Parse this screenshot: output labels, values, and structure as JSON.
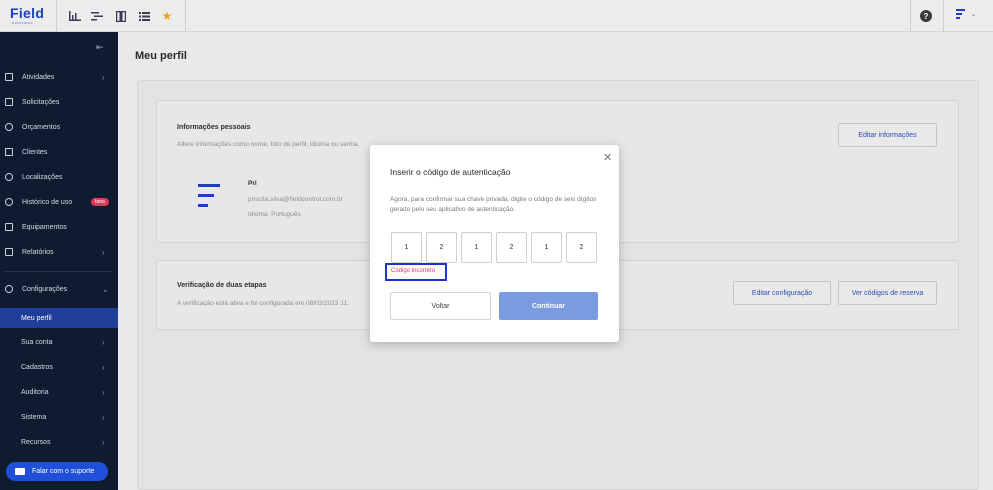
{
  "app": {
    "logo": "Field",
    "logo_sub": "CONTROL"
  },
  "topbar": {
    "icons": [
      "bar-chart-icon",
      "gantt-icon",
      "map-book-icon",
      "list-icon",
      "star-icon"
    ],
    "help": "?",
    "accent": "#1d3fbf"
  },
  "sidebar": {
    "items": [
      {
        "label": "Atividades",
        "icon": "clipboard-icon"
      },
      {
        "label": "Solicitações",
        "icon": "inbox-icon"
      },
      {
        "label": "Orçamentos",
        "icon": "money-icon"
      },
      {
        "label": "Clientes",
        "icon": "contacts-icon"
      },
      {
        "label": "Localizações",
        "icon": "location-pin-icon"
      },
      {
        "label": "Histórico de uso",
        "icon": "history-icon",
        "badge": "beta"
      },
      {
        "label": "Equipamentos",
        "icon": "equipment-icon"
      },
      {
        "label": "Relatórios",
        "icon": "report-icon"
      },
      {
        "label": "Configurações",
        "icon": "gear-icon"
      }
    ],
    "sub_items": [
      {
        "label": "Meu perfil"
      },
      {
        "label": "Sua conta"
      },
      {
        "label": "Cadastros"
      },
      {
        "label": "Auditoria"
      },
      {
        "label": "Sistema"
      },
      {
        "label": "Recursos"
      }
    ],
    "support": "Falar com o suporte"
  },
  "page": {
    "title": "Meu perfil",
    "personal": {
      "heading": "Informações pessoais",
      "desc": "Altere informações como nome, foto de perfil, idioma ou senha.",
      "name": "Pri",
      "email": "priscila.silva@fieldcontrol.com.br",
      "language": "Idioma: Português",
      "edit_button": "Editar informações"
    },
    "twofa": {
      "heading": "Verificação de duas etapas",
      "desc": "A verificação está ativa e foi configurada em 08/03/2023 11:",
      "config_button": "Editar configuração",
      "codes_button": "Ver códigos de reserva"
    }
  },
  "modal": {
    "title": "Inserir o código de autenticação",
    "description": "Agora, para confirmar sua chave privada, digite o código de seis dígitos gerado pelo seu aplicativo de autenticação.",
    "code": [
      "1",
      "2",
      "1",
      "2",
      "1",
      "2"
    ],
    "error": "Código incorreto",
    "back_button": "Voltar",
    "continue_button": "Continuar"
  }
}
